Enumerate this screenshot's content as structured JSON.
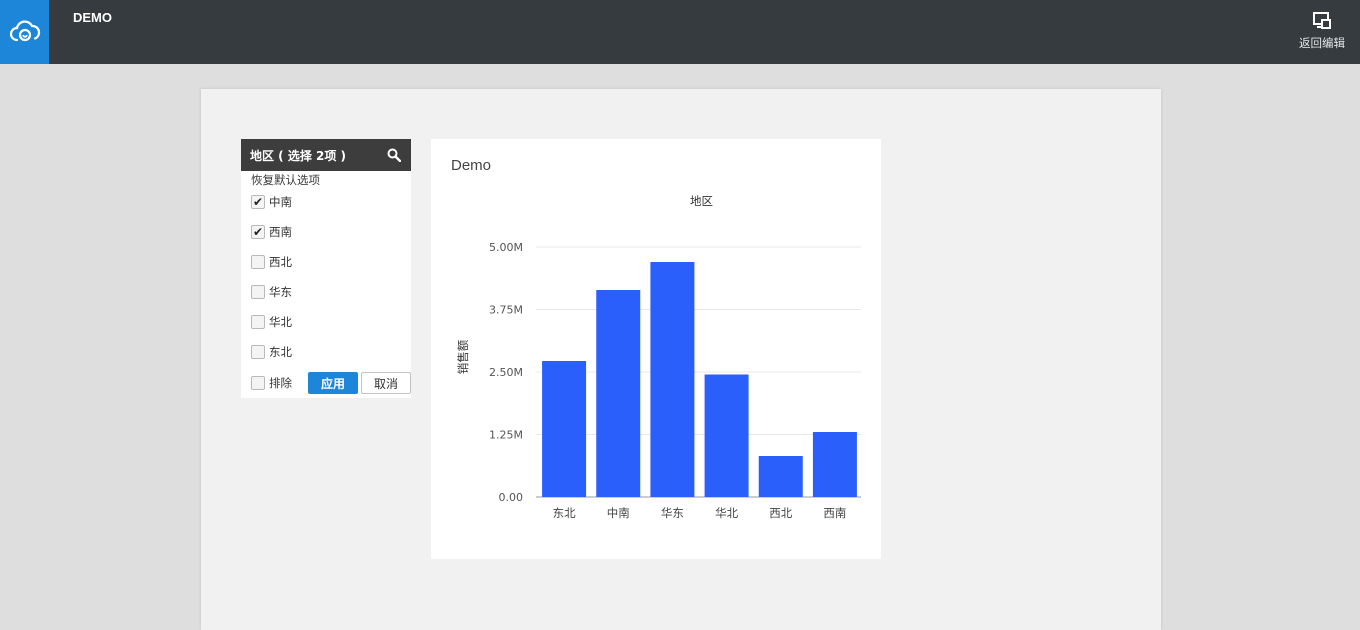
{
  "header": {
    "logo_icon": "cloud-icon",
    "app_title": "DEMO",
    "back_label": "返回编辑",
    "back_icon": "monitor-edit-icon",
    "bg_color": "#353b3e",
    "accent_color": "#1e86d9"
  },
  "filter": {
    "title": "地区 ( 选择 2项 )",
    "search_icon": "search-icon",
    "reset_label": "恢复默认选项",
    "options": [
      {
        "label": "中南",
        "checked": true
      },
      {
        "label": "西南",
        "checked": true
      },
      {
        "label": "西北",
        "checked": false
      },
      {
        "label": "华东",
        "checked": false
      },
      {
        "label": "华北",
        "checked": false
      },
      {
        "label": "东北",
        "checked": false
      }
    ],
    "exclude_label": "排除",
    "exclude_checked": false,
    "apply_label": "应用",
    "cancel_label": "取消"
  },
  "chart_card": {
    "title": "Demo"
  },
  "chart_data": {
    "type": "bar",
    "title": "地区",
    "xlabel": "",
    "ylabel": "销售额",
    "categories": [
      "东北",
      "中南",
      "华东",
      "华北",
      "西北",
      "西南"
    ],
    "values": [
      2.72,
      4.14,
      4.7,
      2.45,
      0.82,
      1.3
    ],
    "unit_suffix": "M",
    "ylim": [
      0,
      5.0
    ],
    "yticks": [
      "0.00",
      "1.25M",
      "2.50M",
      "3.75M",
      "5.00M"
    ],
    "ytick_values": [
      0,
      1.25,
      2.5,
      3.75,
      5.0
    ],
    "grid": true,
    "bar_color": "#2a5ffc"
  }
}
